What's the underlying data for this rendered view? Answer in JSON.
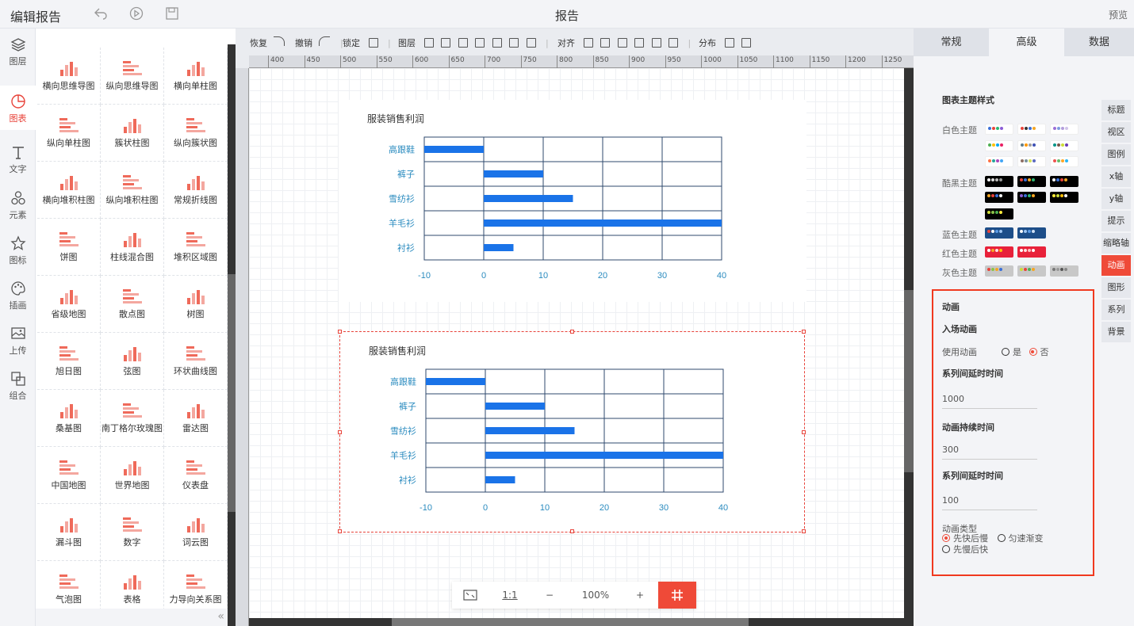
{
  "app": {
    "title": "编辑报告",
    "center_title": "报告",
    "preview": "预览"
  },
  "leftnav": [
    {
      "label": "图层",
      "icon": "layers-icon"
    },
    {
      "label": "图表",
      "icon": "chart-icon"
    },
    {
      "label": "文字",
      "icon": "text-icon"
    },
    {
      "label": "元素",
      "icon": "elements-icon"
    },
    {
      "label": "图标",
      "icon": "star-icon"
    },
    {
      "label": "插画",
      "icon": "palette-icon"
    },
    {
      "label": "上传",
      "icon": "upload-image-icon"
    },
    {
      "label": "组合",
      "icon": "group-icon"
    }
  ],
  "palette": [
    {
      "label": "横向思维导图"
    },
    {
      "label": "纵向思维导图"
    },
    {
      "label": "横向单柱图"
    },
    {
      "label": "纵向单柱图"
    },
    {
      "label": "簇状柱图"
    },
    {
      "label": "纵向簇状图"
    },
    {
      "label": "横向堆积柱图"
    },
    {
      "label": "纵向堆积柱图"
    },
    {
      "label": "常规折线图"
    },
    {
      "label": "饼图"
    },
    {
      "label": "柱线混合图"
    },
    {
      "label": "堆积区域图"
    },
    {
      "label": "省级地图"
    },
    {
      "label": "散点图"
    },
    {
      "label": "树图"
    },
    {
      "label": "旭日图"
    },
    {
      "label": "弦图"
    },
    {
      "label": "环状曲线图"
    },
    {
      "label": "桑基图"
    },
    {
      "label": "南丁格尔玫瑰图"
    },
    {
      "label": "雷达图"
    },
    {
      "label": "中国地图"
    },
    {
      "label": "世界地图"
    },
    {
      "label": "仪表盘"
    },
    {
      "label": "漏斗图"
    },
    {
      "label": "数字"
    },
    {
      "label": "词云图"
    },
    {
      "label": "气泡图"
    },
    {
      "label": "表格"
    },
    {
      "label": "力导向关系图"
    }
  ],
  "toolbar": {
    "redo": "恢复",
    "undo": "撤销",
    "lock": "锁定",
    "layer": "图层",
    "align": "对齐",
    "distribute": "分布"
  },
  "ruler_ticks": [
    "400",
    "450",
    "500",
    "550",
    "600",
    "650",
    "700",
    "750",
    "800",
    "850",
    "900",
    "950",
    "1000",
    "1050",
    "1100",
    "1150",
    "1200",
    "1250"
  ],
  "zoom": {
    "ratio": "1:1",
    "minus": "−",
    "level": "100%",
    "plus": "+"
  },
  "chart_data": [
    {
      "type": "bar",
      "orientation": "horizontal",
      "title": "服装销售利润",
      "categories": [
        "高跟鞋",
        "裤子",
        "雪纺衫",
        "羊毛衫",
        "衬衫"
      ],
      "values": [
        -10,
        10,
        15,
        40,
        5
      ],
      "xlim": [
        -10,
        40
      ],
      "xticks": [
        "-10",
        "0",
        "10",
        "20",
        "30",
        "40"
      ],
      "color": "#1a73e8"
    },
    {
      "type": "bar",
      "orientation": "horizontal",
      "title": "服装销售利润",
      "categories": [
        "高跟鞋",
        "裤子",
        "雪纺衫",
        "羊毛衫",
        "衬衫"
      ],
      "values": [
        -10,
        10,
        15,
        40,
        5
      ],
      "xlim": [
        -10,
        40
      ],
      "xticks": [
        "-10",
        "0",
        "10",
        "20",
        "30",
        "40"
      ],
      "color": "#1a73e8"
    }
  ],
  "rpanel": {
    "tabs": [
      {
        "label": "常规"
      },
      {
        "label": "高级"
      },
      {
        "label": "数据"
      }
    ],
    "sidetabs": [
      {
        "label": "标题"
      },
      {
        "label": "视区"
      },
      {
        "label": "图例"
      },
      {
        "label": "x轴"
      },
      {
        "label": "y轴"
      },
      {
        "label": "提示"
      },
      {
        "label": "缩略轴"
      },
      {
        "label": "动画"
      },
      {
        "label": "图形"
      },
      {
        "label": "系列"
      },
      {
        "label": "背景"
      }
    ],
    "theme_heading": "图表主题样式",
    "themes": {
      "white": "白色主题",
      "dark": "酷黑主题",
      "blue": "蓝色主题",
      "red": "红色主题",
      "gray": "灰色主题"
    },
    "animation": {
      "heading": "动画",
      "sub": "入场动画",
      "use_label": "使用动画",
      "yes": "是",
      "no": "否",
      "use_value": "否",
      "delay_label": "系列间延时时间",
      "delay_value": "1000",
      "duration_label": "动画持续时间",
      "duration_value": "300",
      "delay2_label": "系列间延时时间",
      "delay2_value": "100",
      "type_label": "动画类型",
      "type_opt1": "先快后慢",
      "type_opt2": "匀速渐变",
      "type_opt3": "先慢后快",
      "type_value": "先快后慢"
    }
  },
  "colors": {
    "accent": "#ef4a38",
    "bar": "#1a73e8",
    "axis": "#2f4a6d",
    "label": "#2a8bbf"
  }
}
